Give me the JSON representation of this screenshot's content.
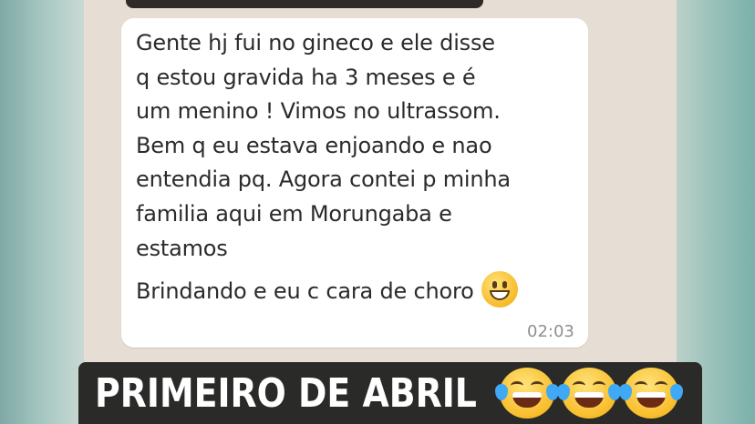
{
  "message": {
    "lines": [
      "Gente hj fui no gineco e ele disse",
      "q estou gravida ha 3 meses e é",
      "um menino ! Vimos no ultrassom.",
      "Bem q eu estava enjoando e nao",
      "entendia pq. Agora contei p minha",
      "familia aqui em Morungaba e",
      "estamos"
    ],
    "last_line": "Brindando e eu c cara de choro",
    "timestamp": "02:03",
    "bubble_color": "#ffffff",
    "text_color": "#2b2b2b"
  },
  "caption": {
    "text": "PRIMEIRO DE ABRIL",
    "emoji_count": 3,
    "emoji_icon": "face-with-tears-of-joy-icon",
    "background": "#2a2a28",
    "text_color": "#ffffff"
  },
  "chat": {
    "background": "#e6ddd4"
  }
}
